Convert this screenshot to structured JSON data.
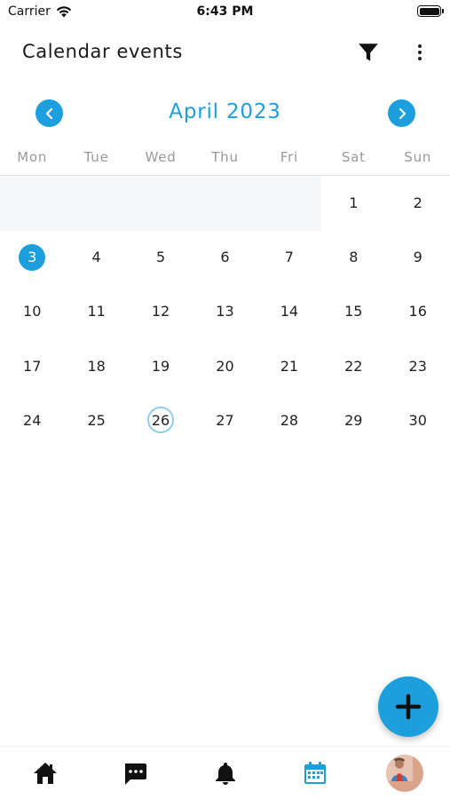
{
  "status_bar": {
    "carrier": "Carrier",
    "time": "6:43 PM"
  },
  "app_bar": {
    "title": "Calendar events",
    "filter_icon": "filter-icon",
    "more_icon": "more-vert-icon"
  },
  "calendar": {
    "month_label": "April 2023",
    "prev_icon": "chevron-left-icon",
    "next_icon": "chevron-right-icon",
    "weekdays": [
      "Mon",
      "Tue",
      "Wed",
      "Thu",
      "Fri",
      "Sat",
      "Sun"
    ],
    "weeks": [
      [
        "",
        "",
        "",
        "",
        "",
        "1",
        "2"
      ],
      [
        "3",
        "4",
        "5",
        "6",
        "7",
        "8",
        "9"
      ],
      [
        "10",
        "11",
        "12",
        "13",
        "14",
        "15",
        "16"
      ],
      [
        "17",
        "18",
        "19",
        "20",
        "21",
        "22",
        "23"
      ],
      [
        "24",
        "25",
        "26",
        "27",
        "28",
        "29",
        "30"
      ]
    ],
    "selected_day": "3",
    "today": "26"
  },
  "fab": {
    "icon": "plus-icon"
  },
  "bottom_nav": {
    "items": [
      {
        "icon": "home-icon",
        "active": false
      },
      {
        "icon": "chat-icon",
        "active": false
      },
      {
        "icon": "bell-icon",
        "active": false
      },
      {
        "icon": "calendar-icon",
        "active": true
      },
      {
        "icon": "avatar",
        "active": false
      }
    ]
  },
  "colors": {
    "accent": "#1c9fdc",
    "today_ring": "#8fcde9",
    "text": "#222222",
    "muted": "#999999"
  }
}
